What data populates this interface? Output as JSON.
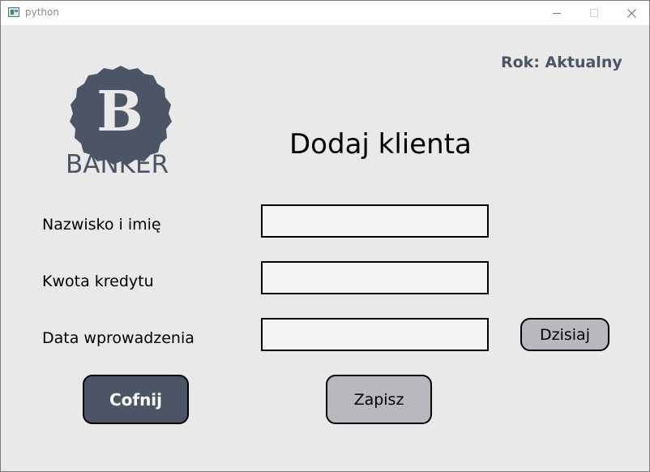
{
  "window": {
    "title": "python",
    "icon": "python-app-icon"
  },
  "header": {
    "year_label": "Rok: Aktualny"
  },
  "logo": {
    "letter": "B",
    "text": "BANKER",
    "icon": "banker-badge-icon"
  },
  "page": {
    "title": "Dodaj klienta"
  },
  "form": {
    "name_label": "Nazwisko i imię",
    "name_value": "",
    "amount_label": "Kwota kredytu",
    "amount_value": "",
    "date_label": "Data wprowadzenia",
    "date_value": "",
    "today_button": "Dzisiaj"
  },
  "actions": {
    "back_label": "Cofnij",
    "save_label": "Zapisz"
  },
  "colors": {
    "accent": "#4c5566",
    "button_gray": "#b8b8bf",
    "background": "#e9e9e9",
    "input_bg": "#f4f4f2"
  }
}
